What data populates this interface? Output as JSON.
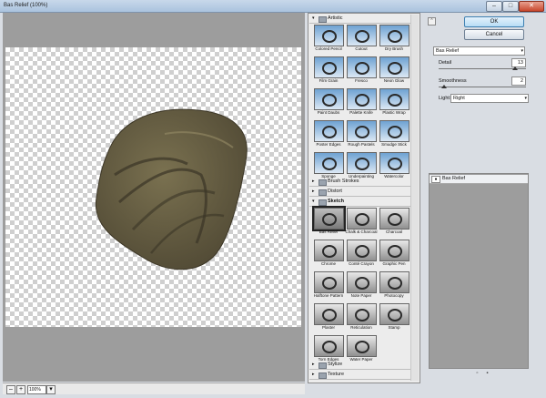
{
  "window": {
    "title": "Bas Relief (100%)",
    "minimize": "–",
    "maximize": "□",
    "close": "✕"
  },
  "preview": {
    "shape_fill": "#6e6548",
    "shape_dark": "#4a4330",
    "zoom": "100%",
    "zoom_out": "–",
    "zoom_in": "+",
    "zoom_arrow": "▾"
  },
  "gallery": {
    "categories": [
      {
        "name": "Artistic",
        "expanded": true
      },
      {
        "name": "Brush Strokes",
        "expanded": false
      },
      {
        "name": "Distort",
        "expanded": false
      },
      {
        "name": "Sketch",
        "expanded": true
      },
      {
        "name": "Stylize",
        "expanded": false
      },
      {
        "name": "Texture",
        "expanded": false
      }
    ],
    "artistic": [
      "Colored Pencil",
      "Cutout",
      "Dry Brush",
      "Film Grain",
      "Fresco",
      "Neon Glow",
      "Paint Daubs",
      "Palette Knife",
      "Plastic Wrap",
      "Poster Edges",
      "Rough Pastels",
      "Smudge Stick",
      "Sponge",
      "Underpainting",
      "Watercolor"
    ],
    "sketch": [
      "Bas Relief",
      "Chalk & Charcoal",
      "Charcoal",
      "Chrome",
      "Conté Crayon",
      "Graphic Pen",
      "Halftone Pattern",
      "Note Paper",
      "Photocopy",
      "Plaster",
      "Reticulation",
      "Stamp",
      "Torn Edges",
      "Water Paper"
    ],
    "selected": "Bas Relief"
  },
  "controls": {
    "ok_label": "OK",
    "cancel_label": "Cancel",
    "collapse_glyph": "⌃",
    "filter_select": "Bas Relief",
    "detail_label": "Detail",
    "detail_value": "13",
    "detail_fraction": 0.87,
    "smoothness_label": "Smoothness",
    "smoothness_value": "2",
    "smoothness_fraction": 0.067,
    "light_label": "Light:",
    "light_value": "Right",
    "dropdown_glyph": "▾"
  },
  "layers": {
    "items": [
      "Bas Relief"
    ],
    "eye_glyph": "●",
    "new_glyph": "▫",
    "delete_glyph": "▪"
  },
  "icons": {
    "folder": "folder-icon",
    "expanded_arrow": "▾",
    "collapsed_arrow": "▸"
  }
}
